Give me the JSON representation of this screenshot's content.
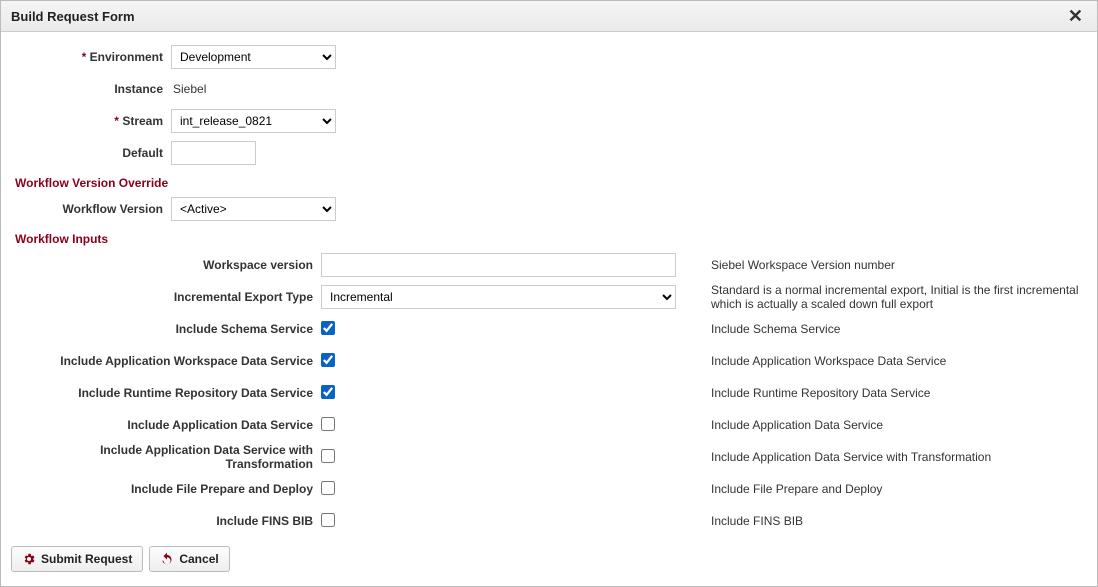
{
  "dialog": {
    "title": "Build Request Form"
  },
  "top": {
    "env_label": "Environment",
    "env_value": "Development",
    "instance_label": "Instance",
    "instance_value": "Siebel",
    "stream_label": "Stream",
    "stream_value": "int_release_0821",
    "default_label": "Default",
    "default_value": ""
  },
  "section_override": "Workflow Version Override",
  "wf_version_label": "Workflow Version",
  "wf_version_value": "<Active>",
  "section_inputs": "Workflow Inputs",
  "inputs": {
    "workspace_version": {
      "label": "Workspace version",
      "value": "",
      "desc": "Siebel Workspace Version number"
    },
    "incr_export_type": {
      "label": "Incremental Export Type",
      "value": "Incremental",
      "desc": "Standard is a normal incremental export, Initial is the first incremental which is actually a scaled down full export"
    },
    "schema_service": {
      "label": "Include Schema Service",
      "checked": true,
      "desc": "Include Schema Service"
    },
    "app_workspace": {
      "label": "Include Application Workspace Data Service",
      "checked": true,
      "desc": "Include Application Workspace Data Service"
    },
    "runtime_repo": {
      "label": "Include Runtime Repository Data Service",
      "checked": true,
      "desc": "Include Runtime Repository Data Service"
    },
    "app_data": {
      "label": "Include Application Data Service",
      "checked": false,
      "desc": "Include Application Data Service"
    },
    "app_data_transform": {
      "label": "Include Application Data Service with Transformation",
      "checked": false,
      "desc": "Include Application Data Service with Transformation"
    },
    "file_prepare": {
      "label": "Include File Prepare and Deploy",
      "checked": false,
      "desc": "Include File Prepare and Deploy"
    },
    "fins_bib": {
      "label": "Include FINS BIB",
      "checked": false,
      "desc": "Include FINS BIB"
    }
  },
  "buttons": {
    "submit": "Submit Request",
    "cancel": "Cancel"
  }
}
